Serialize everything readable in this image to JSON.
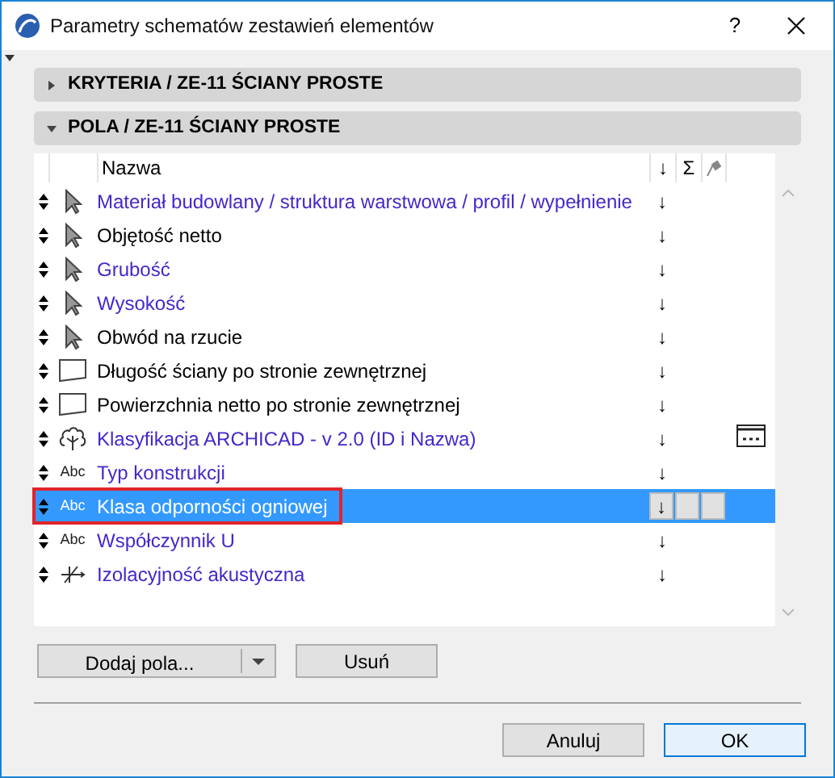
{
  "window": {
    "title": "Parametry schematów zestawień elementów",
    "help": "?"
  },
  "sections": [
    {
      "title": "KRYTERIA / ZE-11 ŚCIANY PROSTE",
      "expanded": false
    },
    {
      "title": "POLA / ZE-11 ŚCIANY PROSTE",
      "expanded": true
    }
  ],
  "columns": {
    "name": "Nazwa",
    "sort": "↓",
    "sum": "Σ"
  },
  "fields": [
    {
      "kind": "pointer",
      "name": "Materiał budowlany / struktura warstwowa / profil / wypełnienie",
      "sort": "↓",
      "color": "#4527c9",
      "selected": false,
      "outlined": false,
      "has_options": false
    },
    {
      "kind": "pointer",
      "name": "Objętość netto",
      "sort": "↓",
      "color": "#000000",
      "selected": false,
      "outlined": false,
      "has_options": false
    },
    {
      "kind": "pointer",
      "name": "Grubość",
      "sort": "↓",
      "color": "#4527c9",
      "selected": false,
      "outlined": false,
      "has_options": false
    },
    {
      "kind": "pointer",
      "name": "Wysokość",
      "sort": "↓",
      "color": "#4527c9",
      "selected": false,
      "outlined": false,
      "has_options": false
    },
    {
      "kind": "pointer",
      "name": "Obwód na rzucie",
      "sort": "↓",
      "color": "#000000",
      "selected": false,
      "outlined": false,
      "has_options": false
    },
    {
      "kind": "surface",
      "name": "Długość ściany po stronie zewnętrznej",
      "sort": "↓",
      "color": "#000000",
      "selected": false,
      "outlined": false,
      "has_options": false
    },
    {
      "kind": "surface",
      "name": "Powierzchnia netto po stronie zewnętrznej",
      "sort": "↓",
      "color": "#000000",
      "selected": false,
      "outlined": false,
      "has_options": false
    },
    {
      "kind": "tree",
      "name": "Klasyfikacja ARCHICAD - v 2.0 (ID i Nazwa)",
      "sort": "↓",
      "color": "#4527c9",
      "selected": false,
      "outlined": false,
      "has_options": true
    },
    {
      "kind": "text",
      "icon_label": "Abc",
      "name": "Typ konstrukcji",
      "sort": "↓",
      "color": "#4527c9",
      "selected": false,
      "outlined": false,
      "has_options": false
    },
    {
      "kind": "text",
      "icon_label": "Abc",
      "name": "Klasa odporności ogniowej",
      "sort": "↓",
      "selected": true,
      "outlined": true,
      "has_options": false
    },
    {
      "kind": "text",
      "icon_label": "Abc",
      "name": "Współczynnik U",
      "sort": "↓",
      "color": "#4527c9",
      "selected": false,
      "outlined": false,
      "has_options": false
    },
    {
      "kind": "insulation",
      "name": "Izolacyjność akustyczna",
      "sort": "↓",
      "color": "#4527c9",
      "selected": false,
      "outlined": false,
      "has_options": false
    }
  ],
  "buttons": {
    "add": "Dodaj pola...",
    "remove": "Usuń",
    "cancel": "Anuluj",
    "ok": "OK"
  }
}
